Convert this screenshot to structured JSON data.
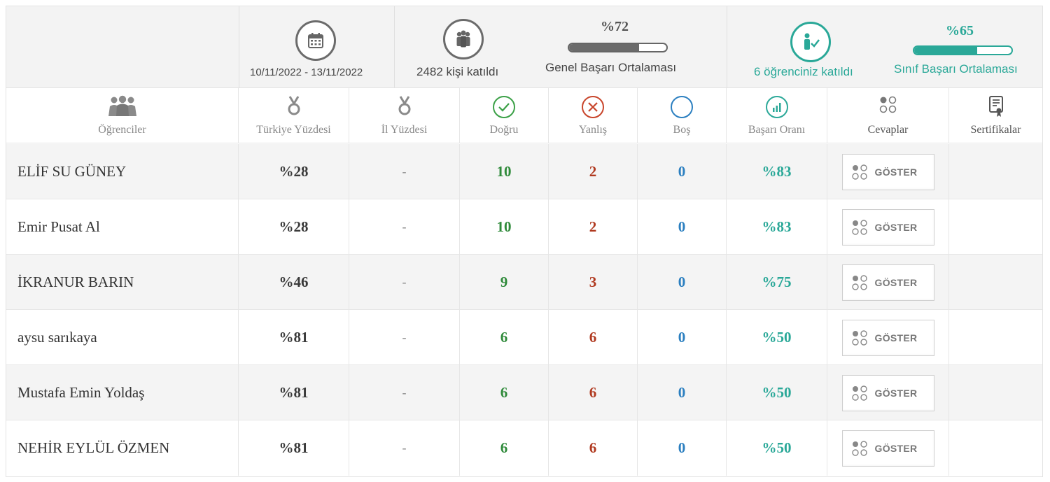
{
  "summary": {
    "date_range": "10/11/2022  - 13/11/2022",
    "participants": "2482 kişi katıldı",
    "general_avg_pct": "%72",
    "general_avg_value": 72,
    "general_avg_label": "Genel Başarı Ortalaması",
    "your_students": "6 öğrenciniz katıldı",
    "class_avg_pct": "%65",
    "class_avg_value": 65,
    "class_avg_label": "Sınıf Başarı Ortalaması"
  },
  "columns": {
    "students": "Öğrenciler",
    "turkey_pct": "Türkiye Yüzdesi",
    "province_pct": "İl Yüzdesi",
    "correct": "Doğru",
    "wrong": "Yanlış",
    "empty": "Boş",
    "success_rate": "Başarı Oranı",
    "answers": "Cevaplar",
    "certificates": "Sertifikalar"
  },
  "rows": [
    {
      "name": "ELİF SU GÜNEY",
      "turkey": "%28",
      "province": "-",
      "correct": "10",
      "wrong": "2",
      "empty": "0",
      "rate": "%83",
      "button": "GÖSTER"
    },
    {
      "name": "Emir Pusat Al",
      "turkey": "%28",
      "province": "-",
      "correct": "10",
      "wrong": "2",
      "empty": "0",
      "rate": "%83",
      "button": "GÖSTER"
    },
    {
      "name": "İKRANUR BARIN",
      "turkey": "%46",
      "province": "-",
      "correct": "9",
      "wrong": "3",
      "empty": "0",
      "rate": "%75",
      "button": "GÖSTER"
    },
    {
      "name": "aysu sarıkaya",
      "turkey": "%81",
      "province": "-",
      "correct": "6",
      "wrong": "6",
      "empty": "0",
      "rate": "%50",
      "button": "GÖSTER"
    },
    {
      "name": "Mustafa Emin Yoldaş",
      "turkey": "%81",
      "province": "-",
      "correct": "6",
      "wrong": "6",
      "empty": "0",
      "rate": "%50",
      "button": "GÖSTER"
    },
    {
      "name": "NEHİR EYLÜL ÖZMEN",
      "turkey": "%81",
      "province": "-",
      "correct": "6",
      "wrong": "6",
      "empty": "0",
      "rate": "%50",
      "button": "GÖSTER"
    }
  ],
  "colors": {
    "teal": "#2aa898",
    "green": "#2f8a3a",
    "red": "#b0391f",
    "blue": "#2b7fc0",
    "gray": "#6b6b6b"
  },
  "icons": [
    "calendar-icon",
    "group-icon",
    "student-check-icon",
    "students-icon",
    "medal-icon",
    "check-circle-icon",
    "x-circle-icon",
    "empty-circle-icon",
    "bar-chart-icon",
    "dots-grid-icon",
    "certificate-icon"
  ]
}
